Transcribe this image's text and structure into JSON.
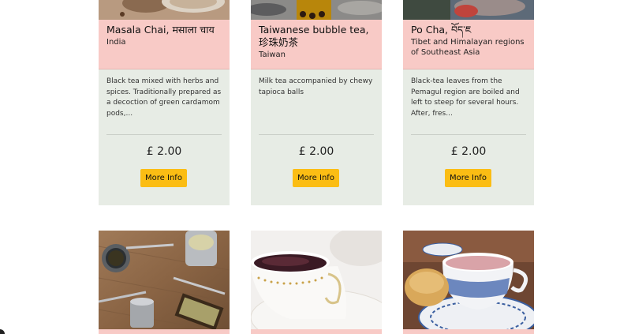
{
  "cards": [
    {
      "title": "Masala Chai, मसाला चाय",
      "origin": "India",
      "description": "Black tea mixed with herbs and spices. Traditionally prepared as a decoction of green cardamom pods,...",
      "price": "£ 2.00",
      "button_label": "More Info"
    },
    {
      "title": "Taiwanese bubble tea, 珍珠奶茶",
      "origin": "Taiwan",
      "description": "Milk tea accompanied by chewy tapioca balls",
      "price": "£ 2.00",
      "button_label": "More Info"
    },
    {
      "title": "Po Cha, བོད་ཇ",
      "origin": "Tibet and Himalayan regions of Southeast Asia",
      "description": "Black-tea leaves from the Pemagul region are boiled and left to steep for several hours. After, fres...",
      "price": "£ 2.00",
      "button_label": "More Info"
    }
  ],
  "photos": [
    {
      "icon": "yerba-mate-photo"
    },
    {
      "icon": "teacup-photo"
    },
    {
      "icon": "pink-tea-photo"
    }
  ],
  "colors": {
    "card_header": "#f8cac6",
    "card_body": "#e7ece5",
    "button": "#fbbd14"
  }
}
